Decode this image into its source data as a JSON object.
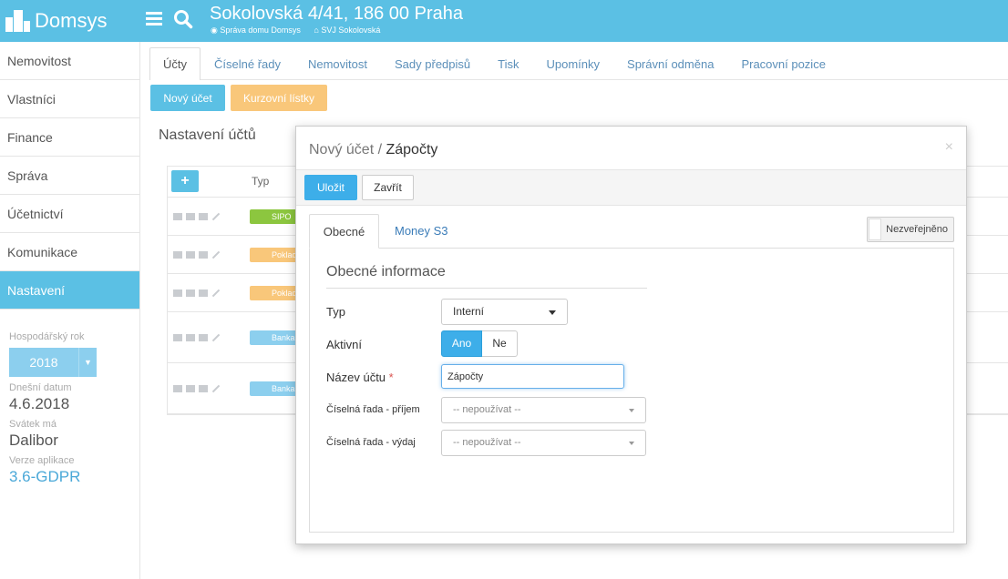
{
  "app": {
    "name": "Domsys"
  },
  "header": {
    "address": "Sokolovská 4/41, 186 00 Praha",
    "crumbs": [
      "Správa domu Domsys",
      "SVJ Sokolovská"
    ]
  },
  "sidebar": {
    "items": [
      {
        "label": "Nemovitost",
        "active": false
      },
      {
        "label": "Vlastníci",
        "active": false
      },
      {
        "label": "Finance",
        "active": false
      },
      {
        "label": "Správa",
        "active": false
      },
      {
        "label": "Účetnictví",
        "active": false
      },
      {
        "label": "Komunikace",
        "active": false
      },
      {
        "label": "Nastavení",
        "active": true
      }
    ],
    "fiscal_year_label": "Hospodářský rok",
    "fiscal_year": "2018",
    "today_label": "Dnešní datum",
    "today": "4.6.2018",
    "nameday_label": "Svátek má",
    "nameday": "Dalibor",
    "version_label": "Verze aplikace",
    "version": "3.6-GDPR"
  },
  "tabs": [
    "Účty",
    "Číselné řady",
    "Nemovitost",
    "Sady předpisů",
    "Tisk",
    "Upomínky",
    "Správní odměna",
    "Pracovní pozice"
  ],
  "toolbar": {
    "new_account": "Nový účet",
    "exchange_rates": "Kurzovní lístky"
  },
  "section_title": "Nastavení účtů",
  "accounts_table": {
    "add_label": "+",
    "type_header": "Typ",
    "rows": [
      {
        "type": "SIPO",
        "color": "#8cc63f"
      },
      {
        "type": "Poklad",
        "color": "#f9c77a"
      },
      {
        "type": "Poklad",
        "color": "#f9c77a"
      },
      {
        "type": "Banka",
        "color": "#8ccfee"
      },
      {
        "type": "Banka",
        "color": "#8ccfee"
      }
    ]
  },
  "modal": {
    "title_prefix": "Nový účet / ",
    "title_name": "Zápočty",
    "close_icon": "×",
    "save_label": "Uložit",
    "close_label": "Zavřít",
    "tabs": [
      "Obecné",
      "Money S3"
    ],
    "verify_label": "Nezveřejněno",
    "section_title": "Obecné informace",
    "fields": {
      "type_label": "Typ",
      "type_value": "Interní",
      "active_label": "Aktivní",
      "active_yes": "Ano",
      "active_no": "Ne",
      "name_label": "Název účtu",
      "required_mark": "*",
      "name_value": "Zápočty",
      "series_income_label": "Číselná řada - příjem",
      "series_income_value": "-- nepoužívat --",
      "series_expense_label": "Číselná řada - výdaj",
      "series_expense_value": "-- nepoužívat --"
    }
  }
}
